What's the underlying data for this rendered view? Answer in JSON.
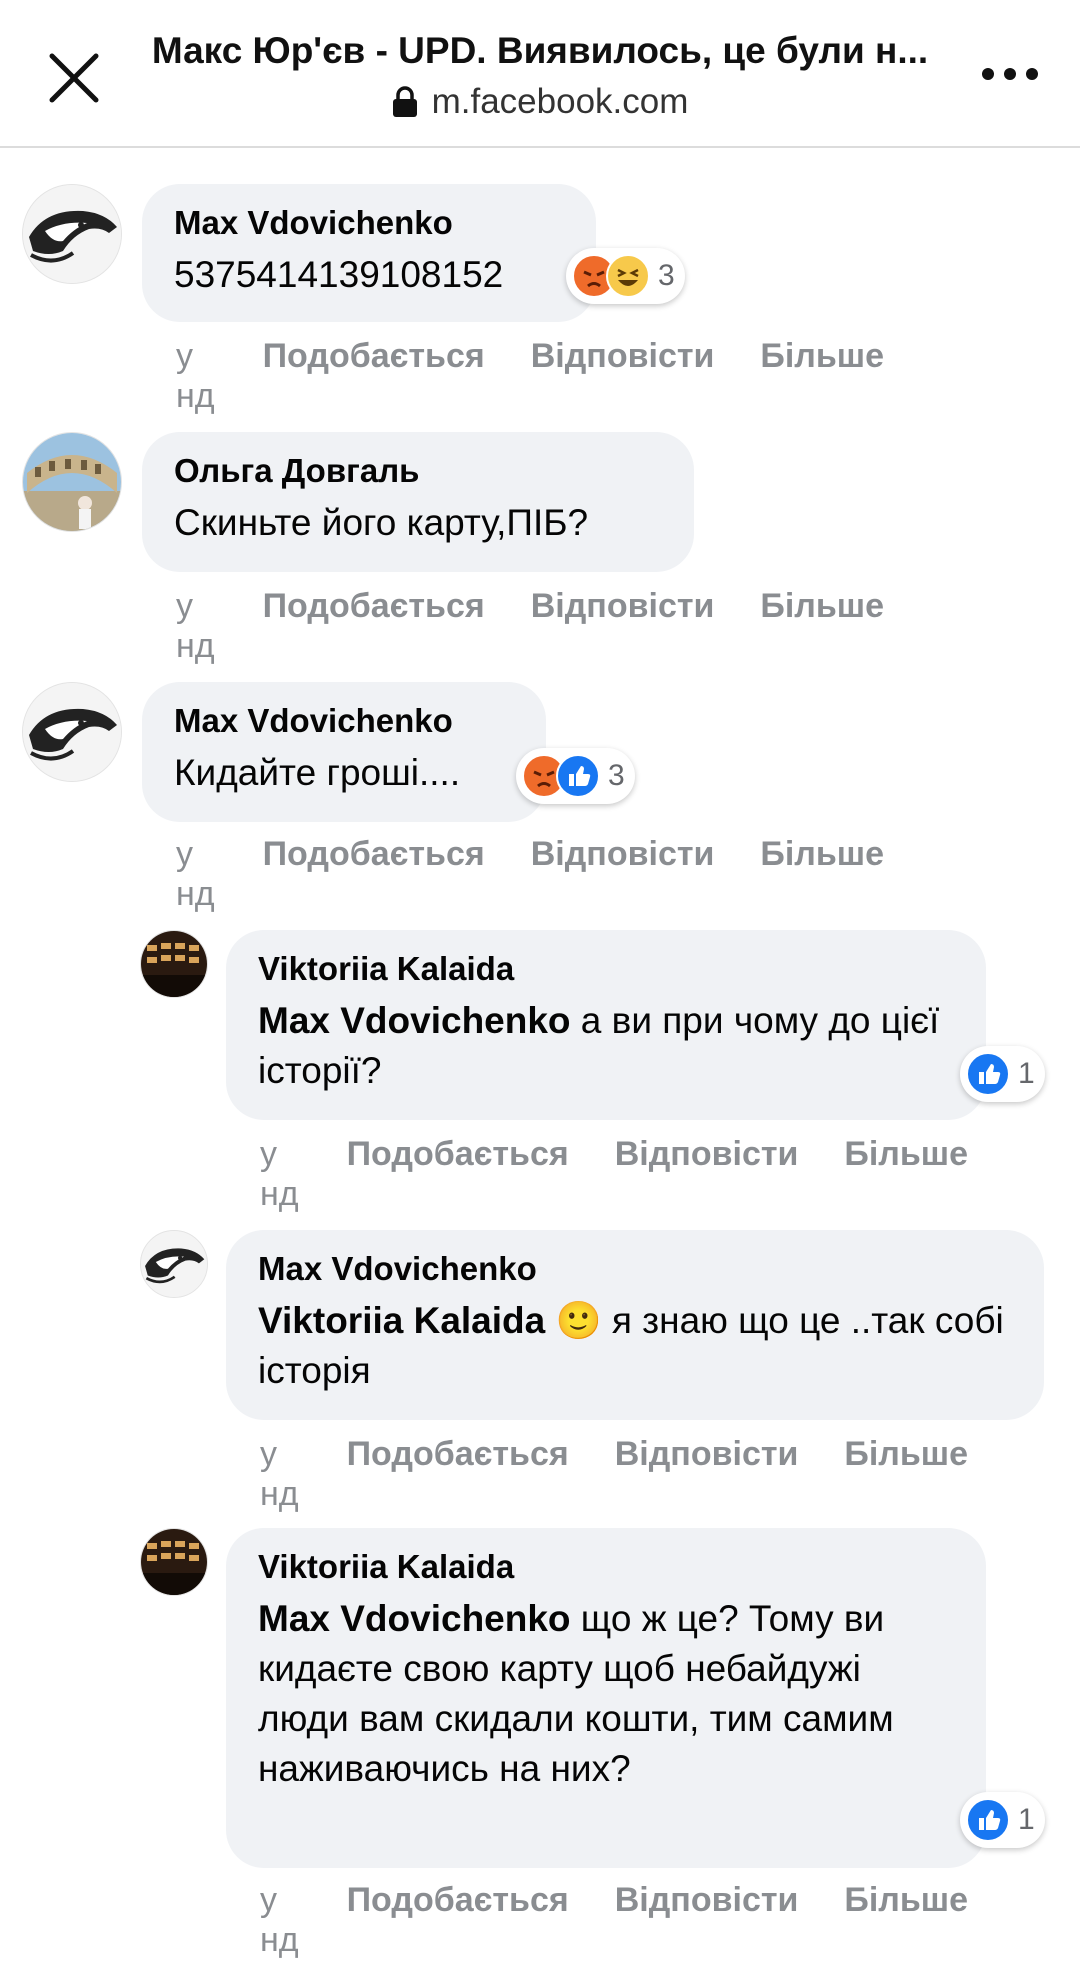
{
  "header": {
    "title": "Макс Юр'єв - UPD. Виявилось, це були н...",
    "url": "m.facebook.com"
  },
  "comments": [
    {
      "author": "Max Vdovichenko",
      "text": "5375414139108152",
      "reactions": [
        "angry",
        "haha"
      ],
      "reaction_count": "3",
      "time": "у нд",
      "like": "Подобається",
      "reply": "Відповісти",
      "more": "Більше"
    },
    {
      "author": "Ольга Довгаль",
      "text": "Скиньте його карту,ПІБ?",
      "time": "у нд",
      "like": "Подобається",
      "reply": "Відповісти",
      "more": "Більше"
    },
    {
      "author": "Max Vdovichenko",
      "text": "Кидайте гроші....",
      "reactions": [
        "angry",
        "like"
      ],
      "reaction_count": "3",
      "time": "у нд",
      "like": "Подобається",
      "reply": "Відповісти",
      "more": "Більше"
    },
    {
      "author": "Viktoriia Kalaida",
      "mention": "Max Vdovichenko",
      "text": " а ви при чому до цієї історії?",
      "reactions": [
        "like"
      ],
      "reaction_count": "1",
      "time": "у нд",
      "like": "Подобається",
      "reply": "Відповісти",
      "more": "Більше"
    },
    {
      "author": "Max Vdovichenko",
      "mention": "Viktoriia Kalaida",
      "text": " 🙂 я знаю що це ..так собі історія",
      "time": "у нд",
      "like": "Подобається",
      "reply": "Відповісти",
      "more": "Більше"
    },
    {
      "author": "Viktoriia Kalaida",
      "mention": "Max Vdovichenko",
      "text": " що ж це? Тому ви кидаєте свою карту щоб небайдужі люди вам скидали кошти, тим самим наживаючись на них?",
      "reactions": [
        "like"
      ],
      "reaction_count": "1",
      "time": "у нд",
      "like": "Подобається",
      "reply": "Відповісти",
      "more": "Більше"
    }
  ],
  "colors": {
    "bubble_bg": "#f0f2f5",
    "like_blue": "#1877f2",
    "action_gray": "#8a8d91",
    "angry_orange": "#f0692a",
    "haha_yellow": "#f7c94b"
  }
}
